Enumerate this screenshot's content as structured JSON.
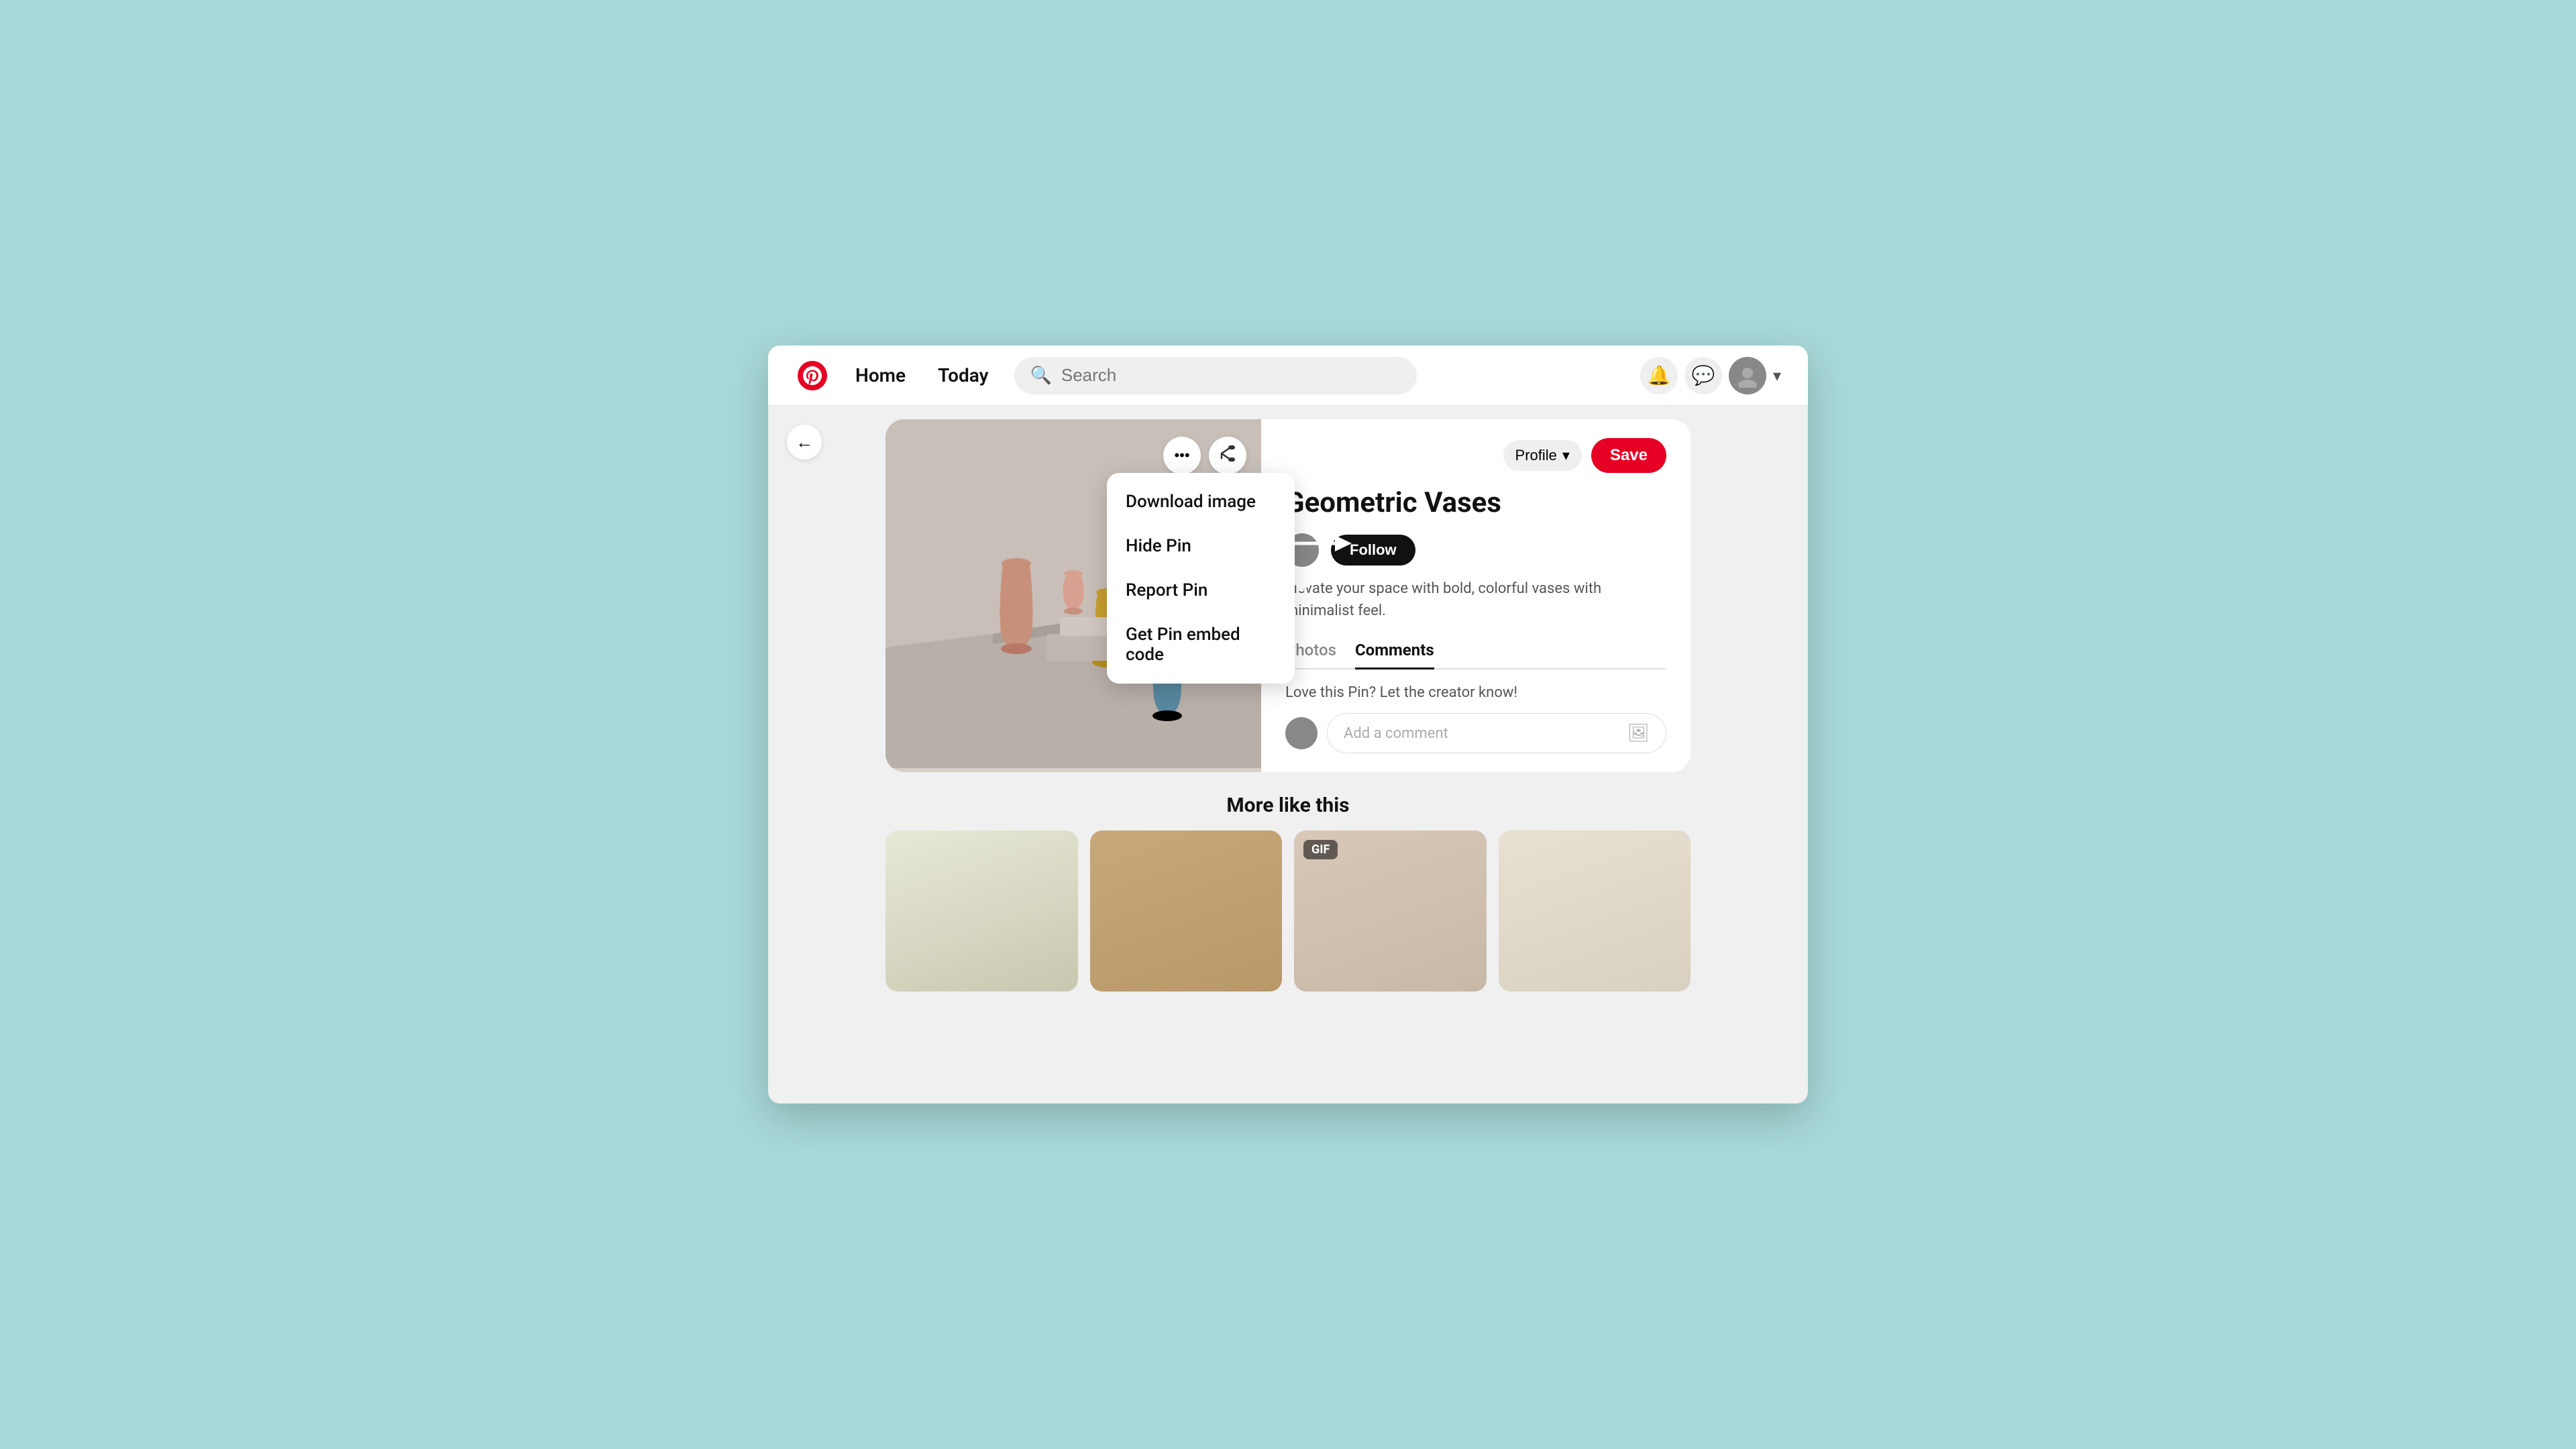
{
  "nav": {
    "logo_color": "#e60023",
    "home_label": "Home",
    "today_label": "Today",
    "search_placeholder": "Search",
    "profile_label": "Profile",
    "save_label": "Save"
  },
  "pin": {
    "title": "Geometric Vases",
    "description": "Elevate your space with bold, colorful vases with minimalist feel.",
    "follow_label": "Follow",
    "tabs": {
      "photos_label": "Photos",
      "comments_label": "Comments"
    },
    "comments_prompt": "Love this Pin? Let the creator know!",
    "comment_placeholder": "Add a comment"
  },
  "dropdown": {
    "download_label": "Download image",
    "hide_label": "Hide Pin",
    "report_label": "Report Pin",
    "embed_label": "Get Pin embed code"
  },
  "more": {
    "section_title": "More like this",
    "gif_badge": "GIF"
  }
}
